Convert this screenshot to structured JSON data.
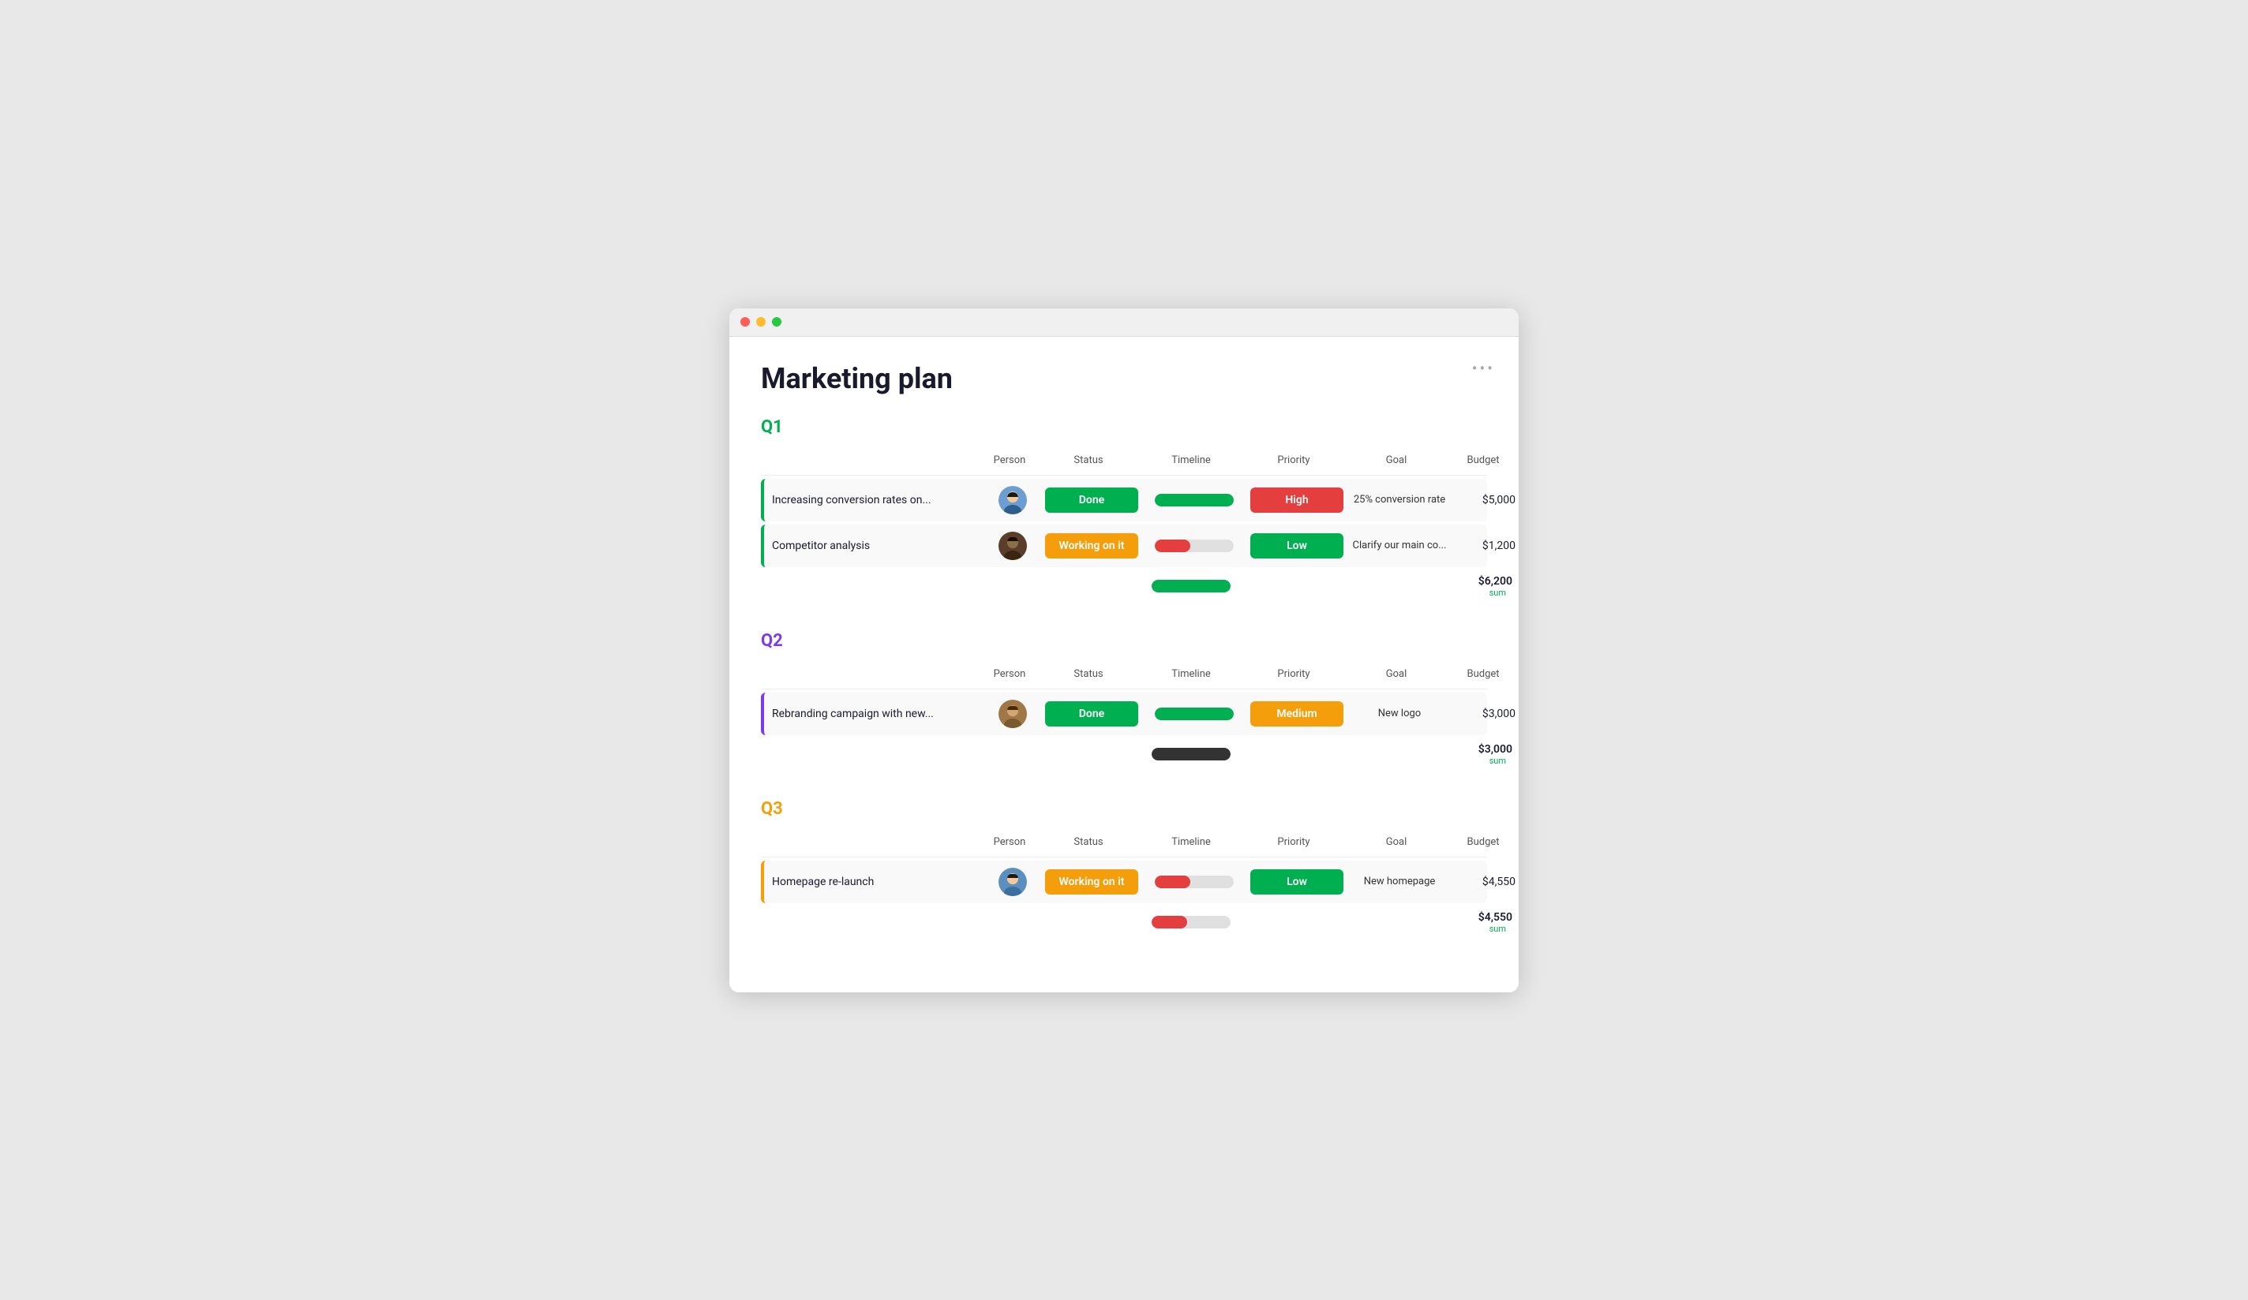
{
  "window": {
    "title": "Marketing plan"
  },
  "page": {
    "title": "Marketing plan",
    "more_icon": "•••"
  },
  "sections": [
    {
      "id": "q1",
      "label": "Q1",
      "color_class": "green",
      "border_class": "green-border",
      "columns": [
        "Person",
        "Status",
        "Timeline",
        "Priority",
        "Goal",
        "Budget"
      ],
      "rows": [
        {
          "task": "Increasing conversion rates on...",
          "avatar_color": "#2d6a9f",
          "avatar_letter": "👩",
          "status": "Done",
          "status_class": "status-done",
          "timeline_type": "full",
          "timeline_color": "green",
          "priority": "High",
          "priority_class": "priority-high",
          "goal": "25% conversion rate",
          "budget": "$5,000"
        },
        {
          "task": "Competitor analysis",
          "avatar_color": "#5a3e2b",
          "avatar_letter": "👨",
          "status": "Working on it",
          "status_class": "status-working",
          "timeline_type": "partial",
          "timeline_color": "red",
          "priority": "Low",
          "priority_class": "priority-low",
          "goal": "Clarify our main co...",
          "budget": "$1,200"
        }
      ],
      "summary": {
        "amount": "$6,200",
        "label": "sum"
      }
    },
    {
      "id": "q2",
      "label": "Q2",
      "color_class": "purple",
      "border_class": "purple-border",
      "columns": [
        "Person",
        "Status",
        "Timeline",
        "Priority",
        "Goal",
        "Budget"
      ],
      "rows": [
        {
          "task": "Rebranding campaign with new...",
          "avatar_color": "#c4a882",
          "avatar_letter": "👨",
          "status": "Done",
          "status_class": "status-done",
          "timeline_type": "full",
          "timeline_color": "green",
          "priority": "Medium",
          "priority_class": "priority-medium",
          "goal": "New logo",
          "budget": "$3,000"
        }
      ],
      "summary": {
        "amount": "$3,000",
        "label": "sum"
      }
    },
    {
      "id": "q3",
      "label": "Q3",
      "color_class": "orange",
      "border_class": "orange-border",
      "columns": [
        "Person",
        "Status",
        "Timeline",
        "Priority",
        "Goal",
        "Budget"
      ],
      "rows": [
        {
          "task": "Homepage re-launch",
          "avatar_color": "#2d6a9f",
          "avatar_letter": "👩",
          "status": "Working on it",
          "status_class": "status-working",
          "timeline_type": "partial",
          "timeline_color": "red",
          "priority": "Low",
          "priority_class": "priority-low",
          "goal": "New homepage",
          "budget": "$4,550"
        }
      ],
      "summary": {
        "amount": "$4,550",
        "label": "sum"
      }
    }
  ]
}
